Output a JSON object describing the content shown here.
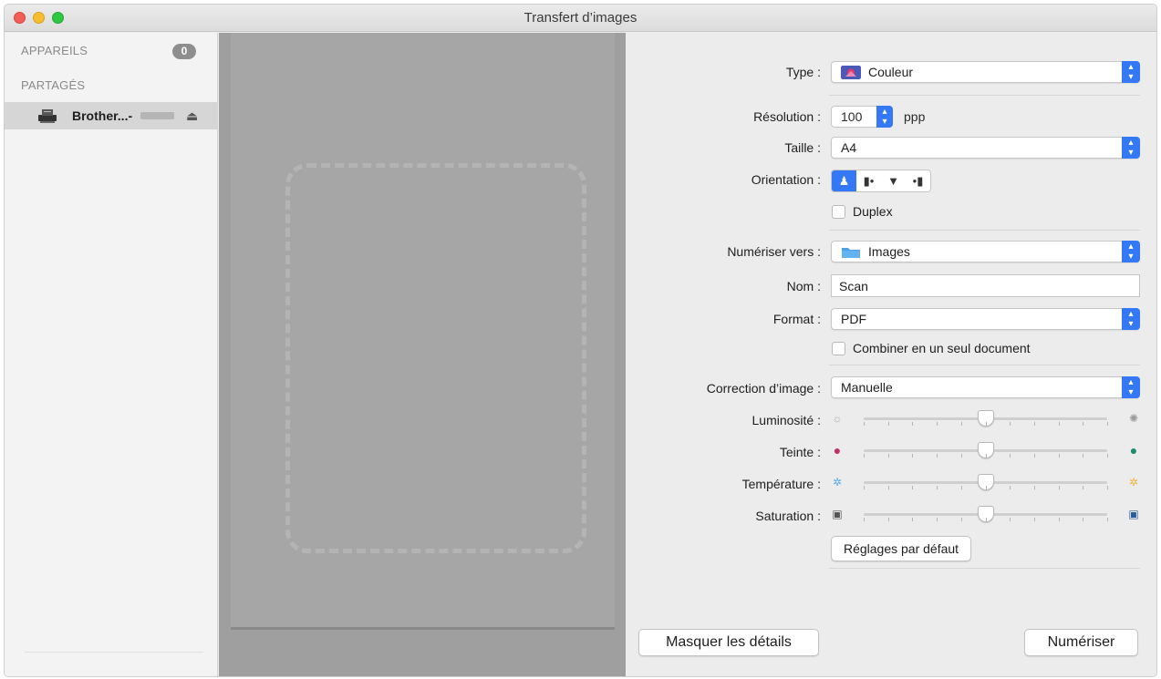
{
  "window": {
    "title": "Transfert d’images"
  },
  "sidebar": {
    "devices_header": "APPAREILS",
    "devices_count": "0",
    "shared_header": "PARTAGÉS",
    "device": {
      "label": "Brother...-",
      "icon": "printer-scanner-icon"
    }
  },
  "details": {
    "type": {
      "label": "Type :",
      "value": "Couleur",
      "icon": "color-photo-icon"
    },
    "resolution": {
      "label": "Résolution :",
      "value": "100",
      "unit": "ppp"
    },
    "size": {
      "label": "Taille :",
      "value": "A4"
    },
    "orientation": {
      "label": "Orientation :",
      "options": [
        "portrait",
        "landscape-left",
        "portrait-upside",
        "landscape-right"
      ],
      "selected": 0
    },
    "duplex": {
      "label": "Duplex",
      "checked": false
    },
    "scan_to": {
      "label": "Numériser vers :",
      "value": "Images",
      "icon": "folder-icon"
    },
    "name": {
      "label": "Nom :",
      "value": "Scan"
    },
    "format": {
      "label": "Format :",
      "value": "PDF"
    },
    "combine": {
      "label": "Combiner en un seul document",
      "checked": false
    },
    "image_correction": {
      "label": "Correction d’image :",
      "value": "Manuelle"
    },
    "brightness": {
      "label": "Luminosité :",
      "value": 0.5
    },
    "tint": {
      "label": "Teinte :",
      "value": 0.5
    },
    "temperature": {
      "label": "Température :",
      "value": 0.5
    },
    "saturation": {
      "label": "Saturation :",
      "value": 0.5
    },
    "defaults_button": "Réglages par défaut"
  },
  "footer": {
    "hide_details_button": "Masquer les détails",
    "scan_button": "Numériser"
  }
}
